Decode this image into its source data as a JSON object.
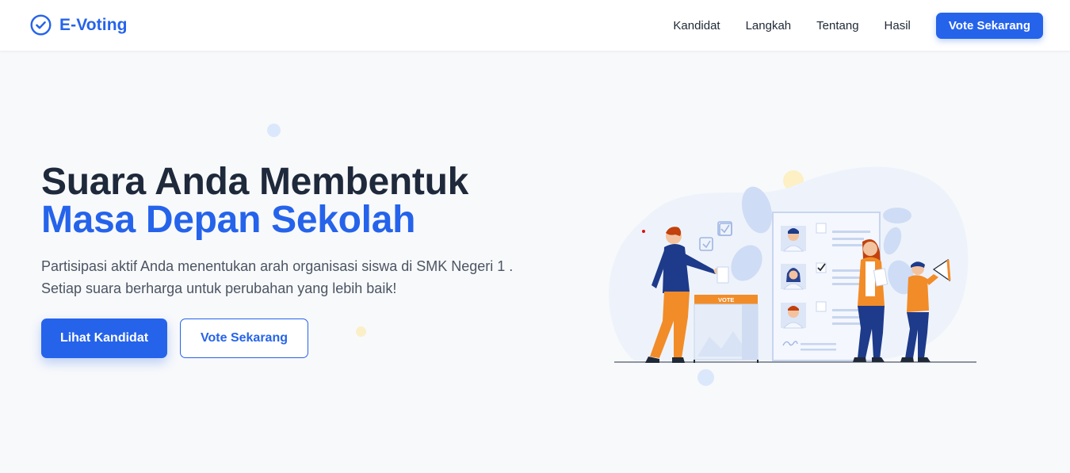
{
  "brand": {
    "name": "E-Voting",
    "icon": "check-circle-icon",
    "color": "#2563eb"
  },
  "nav": {
    "links": [
      "Kandidat",
      "Langkah",
      "Tentang",
      "Hasil"
    ],
    "cta_label": "Vote Sekarang"
  },
  "hero": {
    "title_line1": "Suara Anda Membentuk",
    "title_line2": "Masa Depan Sekolah",
    "subtitle": "Partisipasi aktif Anda menentukan arah organisasi siswa di SMK Negeri 1 . Setiap suara berharga untuk perubahan yang lebih baik!",
    "primary_button": "Lihat Kandidat",
    "secondary_button": "Vote Sekarang"
  },
  "illustration": {
    "ballot_box_label": "VOTE",
    "description_icon": "voting-illustration"
  },
  "colors": {
    "accent": "#2563eb",
    "heading": "#1e293b",
    "background": "#f8f9fb",
    "illustration_orange": "#f28c28",
    "illustration_navy": "#1e3a8a"
  }
}
